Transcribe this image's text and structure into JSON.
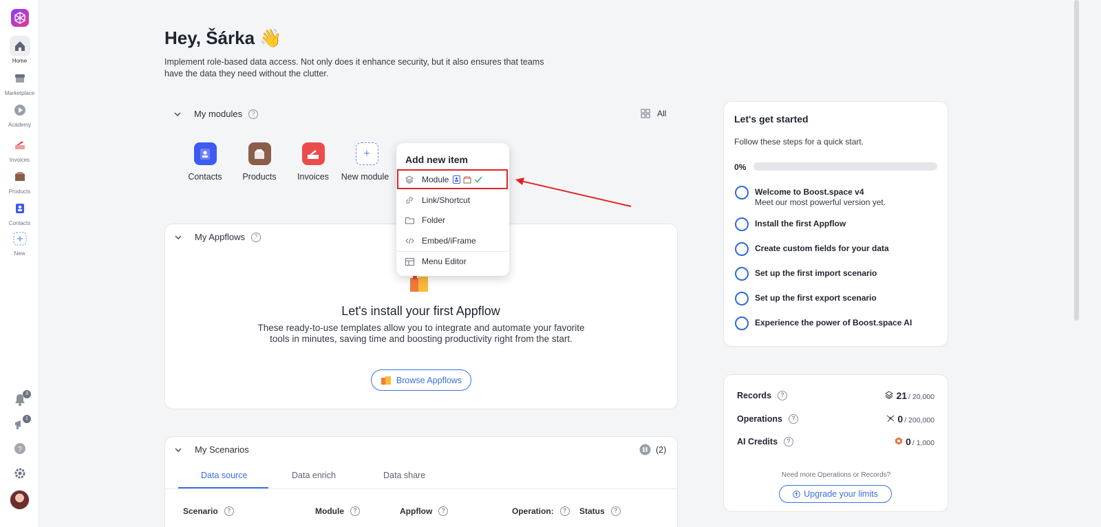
{
  "sidebar": {
    "items": [
      {
        "label": "Home",
        "icon": "home-icon"
      },
      {
        "label": "Marketplace",
        "icon": "store-icon"
      },
      {
        "label": "Academy",
        "icon": "play-icon"
      },
      {
        "label": "Invoices",
        "icon": "invoice-icon"
      },
      {
        "label": "Products",
        "icon": "box-icon"
      },
      {
        "label": "Contacts",
        "icon": "contact-icon"
      },
      {
        "label": "New",
        "icon": "plus-icon"
      }
    ],
    "notifications_count": "3",
    "announcements_count": "1"
  },
  "header": {
    "greeting": "Hey, Šárka 👋",
    "intro": "Implement role-based data access. Not only does it enhance security, but it also ensures that teams have the data they need without the clutter."
  },
  "modules": {
    "title": "My modules",
    "all_label": "All",
    "items": [
      {
        "label": "Contacts",
        "color": "#3d5af1"
      },
      {
        "label": "Products",
        "color": "#8b5e4a"
      },
      {
        "label": "Invoices",
        "color": "#ea4c4c"
      },
      {
        "label": "New module",
        "color": "#5b8def"
      }
    ]
  },
  "dropdown": {
    "title": "Add new item",
    "items": [
      {
        "label": "Module",
        "icon": "layers-icon"
      },
      {
        "label": "Link/Shortcut",
        "icon": "link-icon"
      },
      {
        "label": "Folder",
        "icon": "folder-icon"
      },
      {
        "label": "Embed/iFrame",
        "icon": "code-icon"
      },
      {
        "label": "Menu Editor",
        "icon": "table-icon"
      }
    ]
  },
  "appflows": {
    "title": "My Appflows",
    "empty_title": "Let's install your first Appflow",
    "empty_desc": "These ready-to-use templates allow you to integrate and automate your favorite tools in minutes, saving time and boosting productivity right from the start.",
    "button": "Browse Appflows"
  },
  "scenarios": {
    "title": "My Scenarios",
    "count": "(2)",
    "tabs": [
      "Data source",
      "Data enrich",
      "Data share"
    ],
    "columns": [
      "Scenario",
      "Module",
      "Appflow",
      "Operation:",
      "Status"
    ]
  },
  "getting_started": {
    "title": "Let's get started",
    "subtitle": "Follow these steps for a quick start.",
    "progress_label": "0%",
    "progress": 0,
    "steps": [
      {
        "title": "Welcome to Boost.space v4",
        "desc": "Meet our most powerful version yet."
      },
      {
        "title": "Install the first Appflow"
      },
      {
        "title": "Create custom fields for your data"
      },
      {
        "title": "Set up the first import scenario"
      },
      {
        "title": "Set up the first export scenario"
      },
      {
        "title": "Experience the power of Boost.space AI"
      }
    ]
  },
  "usage": {
    "rows": [
      {
        "label": "Records",
        "value": "21",
        "limit": "/ 20,000",
        "icon": "layers-icon"
      },
      {
        "label": "Operations",
        "value": "0",
        "limit": "/ 200,000",
        "icon": "network-icon"
      },
      {
        "label": "AI Credits",
        "value": "0",
        "limit": "/ 1,000",
        "icon": "ai-credit-icon"
      }
    ],
    "need_more": "Need more Operations or Records?",
    "upgrade_button": "Upgrade your limits"
  },
  "colors": {
    "accent": "#3a6fe2",
    "highlight": "#e02424"
  }
}
